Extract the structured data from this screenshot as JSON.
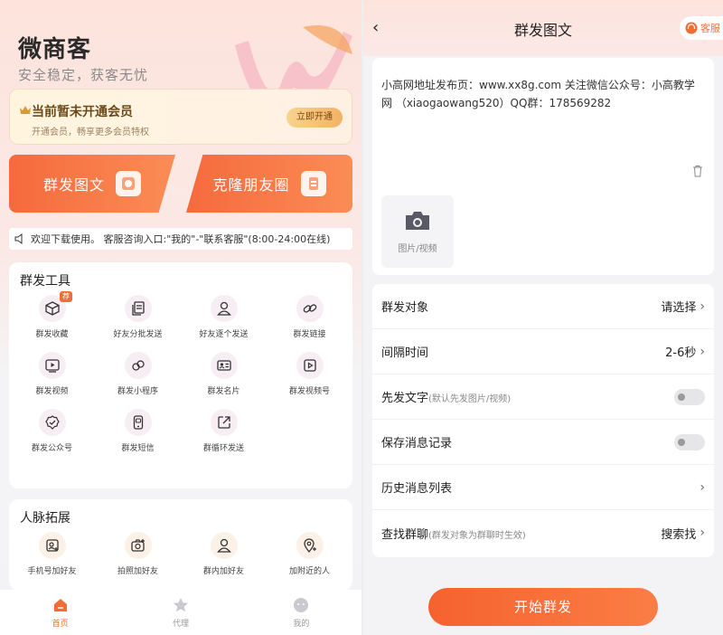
{
  "left": {
    "brand": "微商客",
    "slogan": "安全稳定，获客无忧",
    "vip": {
      "title": "当前暂未开通会员",
      "subtitle": "开通会员，畅享更多会员特权",
      "button": "立即开通"
    },
    "main_buttons": {
      "mass": "群发图文",
      "clone": "克隆朋友圈"
    },
    "notice": "欢迎下载使用。 客服咨询入口:\"我的\"-\"联系客服\"(8:00-24:00在线)",
    "tools": {
      "title": "群发工具",
      "items": [
        {
          "label": "群发收藏",
          "icon": "cube-icon",
          "badge": "荐"
        },
        {
          "label": "好友分批发送",
          "icon": "document-stack-icon"
        },
        {
          "label": "好友逐个发送",
          "icon": "person-icon"
        },
        {
          "label": "群发链接",
          "icon": "link-icon"
        },
        {
          "label": "群发视频",
          "icon": "video-icon"
        },
        {
          "label": "群发小程序",
          "icon": "mini-program-icon"
        },
        {
          "label": "群发名片",
          "icon": "id-card-icon"
        },
        {
          "label": "群发视频号",
          "icon": "channels-icon"
        },
        {
          "label": "群发公众号",
          "icon": "badge-check-icon"
        },
        {
          "label": "群发短信",
          "icon": "phone-message-icon"
        },
        {
          "label": "群循环发送",
          "icon": "share-loop-icon"
        }
      ]
    },
    "contacts": {
      "title": "人脉拓展",
      "items": [
        {
          "label": "手机号加好友",
          "icon": "phone-add-icon"
        },
        {
          "label": "拍照加好友",
          "icon": "camera-add-icon"
        },
        {
          "label": "群内加好友",
          "icon": "group-person-icon"
        },
        {
          "label": "加附近的人",
          "icon": "location-add-icon"
        }
      ]
    },
    "tabs": [
      {
        "label": "首页",
        "icon": "home-icon",
        "active": true
      },
      {
        "label": "代理",
        "icon": "star-icon",
        "active": false
      },
      {
        "label": "我的",
        "icon": "smiley-icon",
        "active": false
      }
    ]
  },
  "right": {
    "title": "群发图文",
    "service": "客服",
    "message": "小高网地址发布页：www.xx8g.com  关注微信公众号：小高教学网 （xiaogaowang520）QQ群：178569282",
    "media_label": "图片/视频",
    "rows": [
      {
        "label": "群发对象",
        "hint": "",
        "value": "请选择",
        "type": "select"
      },
      {
        "label": "间隔时间",
        "hint": "",
        "value": "2-6秒",
        "type": "select"
      },
      {
        "label": "先发文字",
        "hint": "(默认先发图片/视频)",
        "value": "",
        "type": "toggle"
      },
      {
        "label": "保存消息记录",
        "hint": "",
        "value": "",
        "type": "toggle"
      },
      {
        "label": "历史消息列表",
        "hint": "",
        "value": "",
        "type": "link"
      },
      {
        "label": "查找群聊",
        "hint": "(群发对象为群聊时生效)",
        "value": "搜索找",
        "type": "select"
      }
    ],
    "start_button": "开始群发"
  },
  "colors": {
    "accent": "#f26d33",
    "vip_text": "#6b4a18"
  }
}
